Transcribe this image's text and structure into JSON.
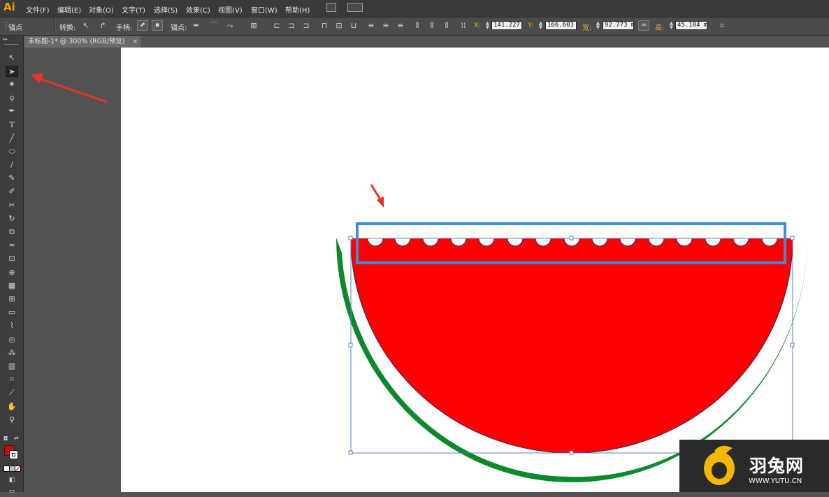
{
  "app": {
    "logo": "Ai"
  },
  "menubar": {
    "items": [
      "文件(F)",
      "编辑(E)",
      "对象(O)",
      "文字(T)",
      "选择(S)",
      "效果(C)",
      "视图(V)",
      "窗口(W)",
      "帮助(H)"
    ]
  },
  "control_bar": {
    "mode_label": "锚点",
    "convert_label": "转换:",
    "handles_label": "手柄:",
    "anchors_label": "锚点:",
    "x_label": "X:",
    "x_value": "141.227 ı",
    "y_label": "Y:",
    "y_value": "166.603 ı",
    "w_label": "宽:",
    "w_value": "92.773 m",
    "h_label": "高:",
    "h_value": "45.104 m"
  },
  "document_tab": {
    "title": "未标题-1* @ 300% (RGB/预览)",
    "close": "×"
  },
  "watermark": {
    "brand": "羽兔网",
    "url": "WWW.YUTU.CN"
  },
  "colors": {
    "melon_red": "#ff0000",
    "rind_green": "#0a8a2a",
    "highlight_box": "#3a8fd8",
    "annotation_arrow": "#e8332a",
    "logo_orange": "#ff9a00",
    "watermark_yellow": "#f5b800"
  },
  "icons": {
    "selection": "selection-arrow-icon",
    "direct_selection": "direct-selection-icon"
  }
}
